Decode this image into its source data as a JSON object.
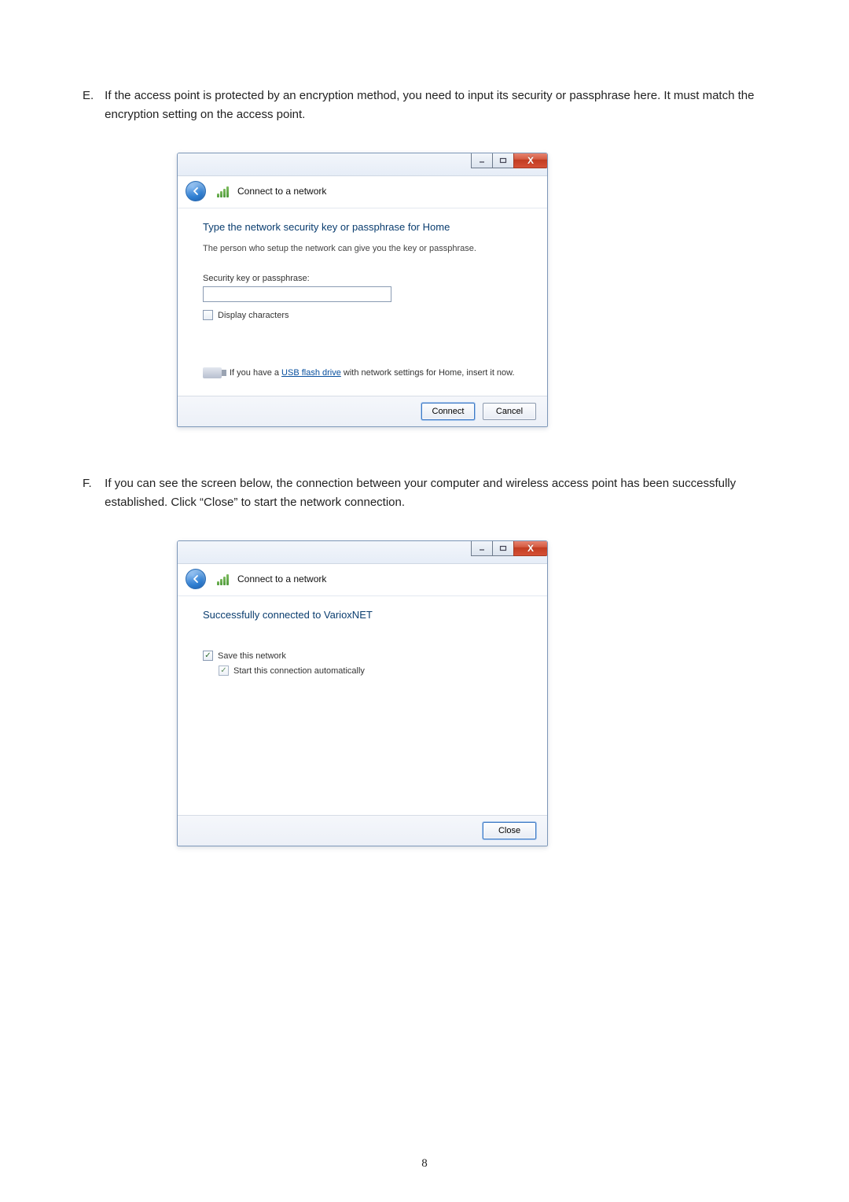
{
  "page_number": "8",
  "steps": {
    "e": {
      "letter": "E.",
      "text": "If the access point is protected by an encryption method, you need to input its security or passphrase here. It must match the encryption setting on the access point."
    },
    "f": {
      "letter": "F.",
      "text": "If you can see the screen below, the connection between your computer and wireless access point has been successfully established. Click “Close” to start the network connection."
    }
  },
  "dialog1": {
    "title": "Connect to a network",
    "heading": "Type the network security key or passphrase for Home",
    "subtext": "The person who setup the network can give you the key or passphrase.",
    "input_label": "Security key or passphrase:",
    "input_value": "",
    "display_chars": "Display characters",
    "usb_pre": "If you have a ",
    "usb_link": "USB flash drive",
    "usb_post": " with network settings for Home, insert it now.",
    "connect": "Connect",
    "cancel": "Cancel"
  },
  "dialog2": {
    "title": "Connect to a network",
    "heading": "Successfully connected to VarioxNET",
    "save_net": "Save this network",
    "auto_start": "Start this connection automatically",
    "close": "Close"
  }
}
